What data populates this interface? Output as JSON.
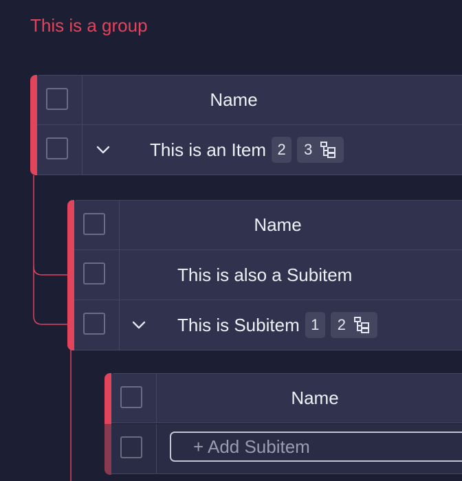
{
  "group": {
    "title": "This is a group",
    "accent_color": "#e2445c"
  },
  "items_table": {
    "header": {
      "name_label": "Name"
    },
    "item": {
      "name": "This is an Item",
      "update_count": "2",
      "subitem_count": "3",
      "expand_icon": "chevron-down-icon",
      "subitems_icon": "subitems-tree-icon"
    }
  },
  "subitems_table": {
    "header": {
      "name_label": "Name"
    },
    "rows": [
      {
        "name": "This is also a Subitem"
      },
      {
        "name": "This is Subitem",
        "update_count": "1",
        "subitem_count": "2",
        "expand_icon": "chevron-down-icon",
        "subitems_icon": "subitems-tree-icon"
      }
    ]
  },
  "nested_table": {
    "header": {
      "name_label": "Name"
    },
    "add_row": {
      "placeholder": "+ Add Subitem"
    }
  }
}
